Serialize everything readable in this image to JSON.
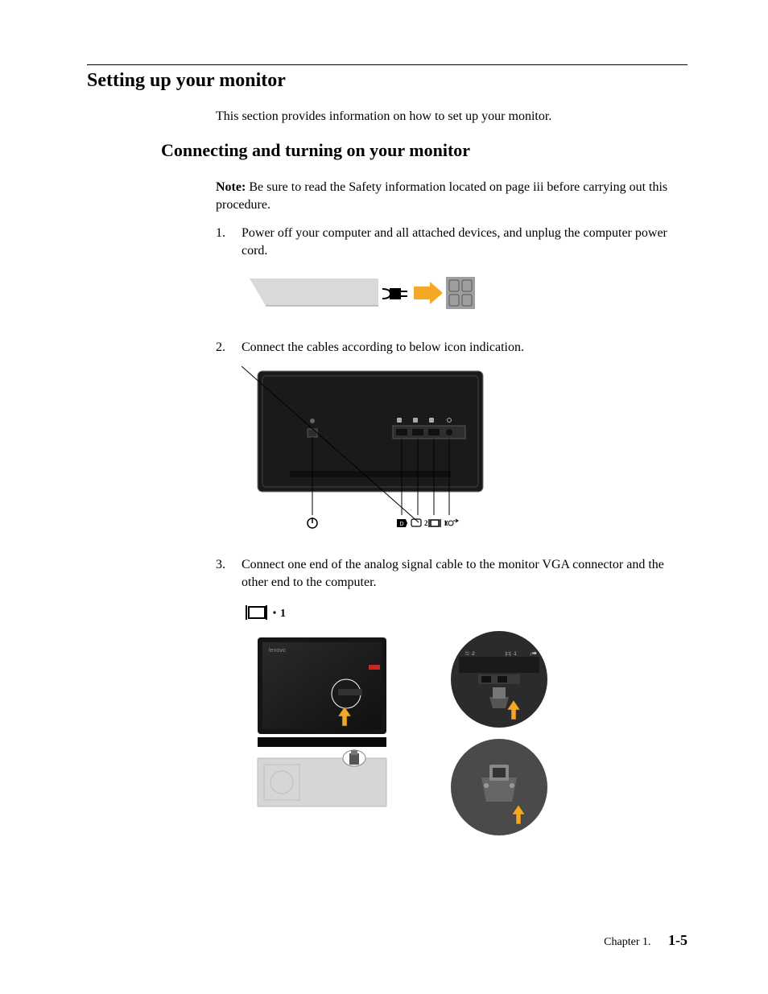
{
  "heading_main": "Setting up your monitor",
  "intro": "This section provides information on how to set up your monitor.",
  "heading_sub": "Connecting and turning on your monitor",
  "note_label": "Note:",
  "note_text": " Be sure to read the Safety information located on page iii before carrying out this procedure.",
  "steps": {
    "s1": "Power off your computer and all attached devices, and unplug the computer power cord.",
    "s2": "Connect the cables according to below icon indication.",
    "s3": "Connect one end of the analog signal cable to the monitor VGA connector and the other end to the computer."
  },
  "port_labels": {
    "hdmi2": "2",
    "vga1": "1",
    "step3_label": "1"
  },
  "footer": {
    "chapter": "Chapter 1.",
    "page": "1-5"
  }
}
